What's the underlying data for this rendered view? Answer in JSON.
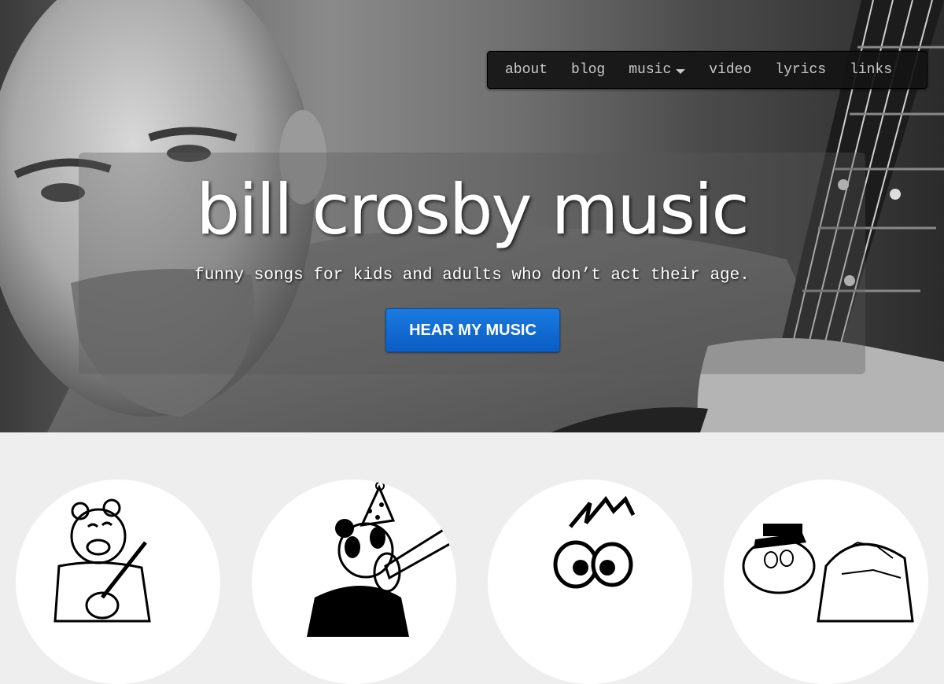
{
  "nav": {
    "items": [
      {
        "label": "about"
      },
      {
        "label": "blog"
      },
      {
        "label": "music",
        "has_dropdown": true
      },
      {
        "label": "video"
      },
      {
        "label": "lyrics"
      },
      {
        "label": "links"
      }
    ]
  },
  "hero": {
    "title": "bill crosby music",
    "tagline": "funny songs for kids and adults who don’t act their age.",
    "cta_label": "HEAR MY MUSIC"
  },
  "features": [
    {
      "icon": "bear-ukulele-icon"
    },
    {
      "icon": "panda-trombone-icon"
    },
    {
      "icon": "cartoon-eyes-icon"
    },
    {
      "icon": "turtle-icon"
    }
  ],
  "colors": {
    "cta": "#0b5cc4",
    "nav_bg": "#141414",
    "page_bg": "#eeeeee"
  }
}
